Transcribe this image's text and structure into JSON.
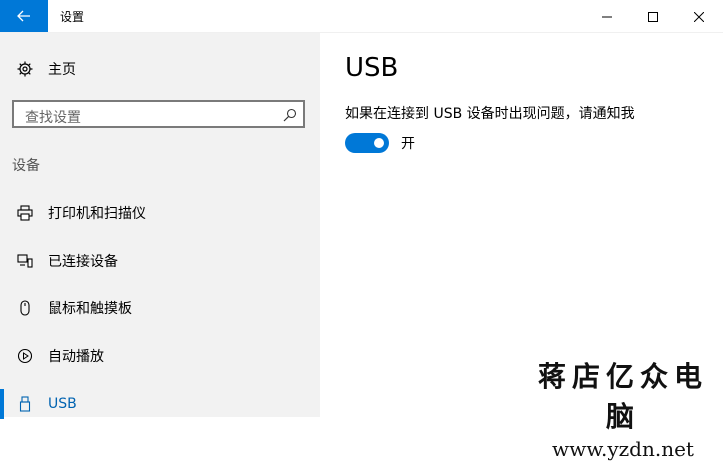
{
  "window": {
    "title": "设置"
  },
  "sidebar": {
    "home_label": "主页",
    "search_placeholder": "查找设置",
    "section_heading": "设备",
    "items": [
      {
        "label": "打印机和扫描仪",
        "icon": "printer-icon"
      },
      {
        "label": "已连接设备",
        "icon": "connected-devices-icon"
      },
      {
        "label": "鼠标和触摸板",
        "icon": "mouse-icon"
      },
      {
        "label": "自动播放",
        "icon": "autoplay-icon"
      },
      {
        "label": "USB",
        "icon": "usb-icon",
        "active": true
      }
    ]
  },
  "main": {
    "title": "USB",
    "notify_text": "如果在连接到 USB 设备时出现问题，请通知我",
    "toggle_state": "开",
    "toggle_on": true
  },
  "watermark": {
    "line1": "蒋店亿众电脑",
    "line2": "www.yzdn.net"
  },
  "colors": {
    "accent": "#0078d7",
    "active_text": "#0063b1",
    "sidebar_bg": "#f2f2f2"
  }
}
